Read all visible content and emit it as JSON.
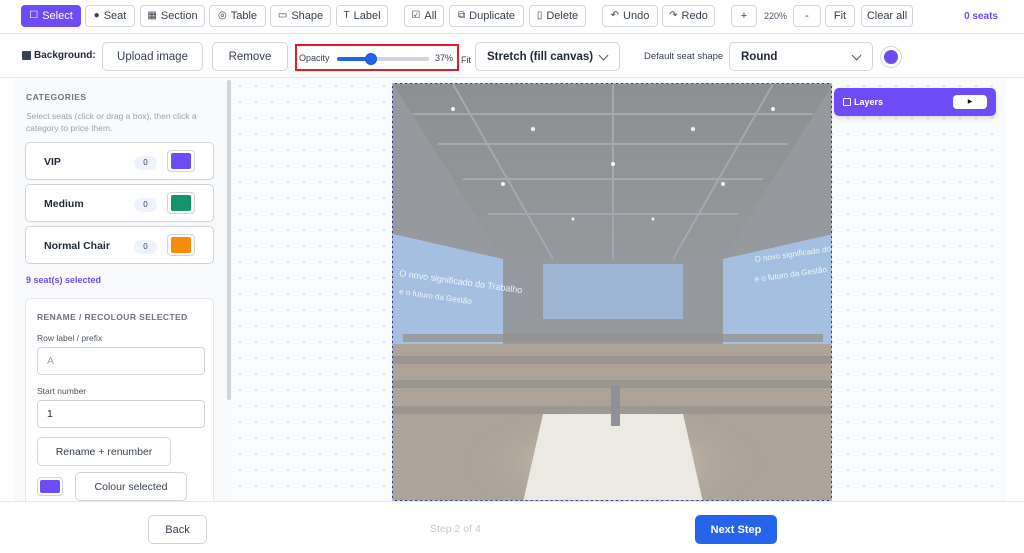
{
  "toolbar": {
    "select": "Select",
    "seat": "Seat",
    "section": "Section",
    "table": "Table",
    "shape": "Shape",
    "label": "Label",
    "all": "All",
    "duplicate": "Duplicate",
    "delete": "Delete",
    "undo": "Undo",
    "redo": "Redo",
    "zoom_in": "+",
    "zoom_level": "220%",
    "zoom_out": "-",
    "fit": "Fit",
    "clear_all": "Clear all",
    "seats_count": "0 seats"
  },
  "options": {
    "background_label": "Background:",
    "upload_image": "Upload image",
    "remove": "Remove",
    "opacity_label": "Opacity",
    "opacity_value": "37%",
    "opacity_fraction": 0.37,
    "fit_label": "Fit",
    "fit_value": "Stretch (fill canvas)",
    "default_seat_shape_label": "Default seat shape",
    "default_seat_shape_value": "Round",
    "seat_color": "#6d4bf5"
  },
  "sidebar": {
    "categories_heading": "CATEGORIES",
    "categories_help": "Select seats (click or drag a box), then click a category to price them.",
    "categories": [
      {
        "name": "VIP",
        "count": "0",
        "color": "#6d4bf5"
      },
      {
        "name": "Medium",
        "count": "0",
        "color": "#14946b"
      },
      {
        "name": "Normal Chair",
        "count": "0",
        "color": "#f78c0c"
      }
    ],
    "selected_count": "9 seat(s) selected",
    "rename": {
      "heading": "RENAME / RECOLOUR SELECTED",
      "row_label": "Row label / prefix",
      "row_placeholder": "A",
      "start_label": "Start number",
      "start_value": "1",
      "rename_button": "Rename + renumber",
      "colour_button": "Colour selected",
      "colour": "#6d4bf5"
    }
  },
  "canvas": {
    "image_text_left": "O novo significado do Trabalho",
    "image_text_left2": "e o futuro da Gestão",
    "image_text_right": "O novo significado do Trabalho",
    "image_text_right2": "e o futuro da Gestão"
  },
  "layers": {
    "title": "Layers",
    "toggle_icon": "play-icon"
  },
  "footer": {
    "back": "Back",
    "step": "Step 2 of 4",
    "next": "Next Step"
  }
}
